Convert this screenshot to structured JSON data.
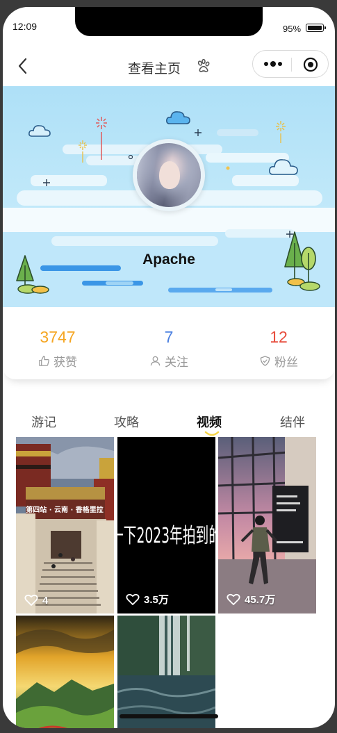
{
  "status_bar": {
    "time": "12:09",
    "battery": "95%"
  },
  "navbar": {
    "title": "查看主页",
    "back_icon": "chevron-left-icon",
    "paw_icon": "paw-icon",
    "menu_icon": "more-dots-icon",
    "close_icon": "target-icon"
  },
  "profile": {
    "name": "Apache"
  },
  "stats": [
    {
      "value": "3747",
      "label": "获赞",
      "icon": "thumbs-up-icon",
      "color": "#f5a623"
    },
    {
      "value": "7",
      "label": "关注",
      "icon": "user-icon",
      "color": "#4a7fe0"
    },
    {
      "value": "12",
      "label": "粉丝",
      "icon": "shield-icon",
      "color": "#e74c3c"
    }
  ],
  "tabs": [
    {
      "label": "游记",
      "active": false
    },
    {
      "label": "攻略",
      "active": false
    },
    {
      "label": "视频",
      "active": true
    },
    {
      "label": "结伴",
      "active": false
    }
  ],
  "videos": [
    {
      "likes": "4",
      "overlay_text": "第四站 · 云南 · 香格里拉"
    },
    {
      "likes": "3.5万",
      "overlay_text": "一下2023年拍到的"
    },
    {
      "likes": "45.7万",
      "overlay_text": ""
    },
    {
      "likes": "",
      "overlay_text": ""
    },
    {
      "likes": "",
      "overlay_text": ""
    }
  ],
  "colors": {
    "accent_orange": "#f5a623",
    "accent_blue": "#4a7fe0",
    "accent_red": "#e74c3c",
    "banner_sky": "#aee0f7"
  }
}
